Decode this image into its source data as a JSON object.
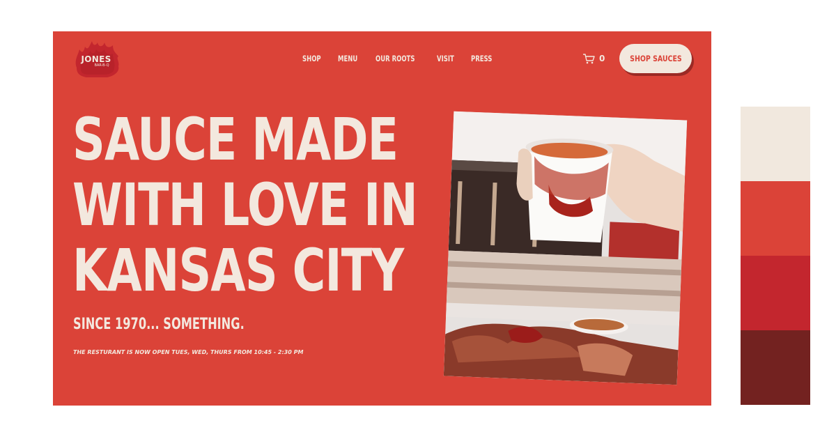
{
  "brand": {
    "name": "JONES",
    "sub": "BAR-B-Q"
  },
  "nav": {
    "items": [
      "SHOP",
      "MENU",
      "OUR ROOTS",
      "VISIT",
      "PRESS"
    ]
  },
  "cart": {
    "count": "0",
    "icon": "cart-icon"
  },
  "cta": {
    "label": "SHOP SAUCES"
  },
  "hero": {
    "headline_lines": [
      "SAUCE MADE",
      "WITH LOVE IN",
      "KANSAS CITY"
    ],
    "tagline": "SINCE 1970... SOMETHING.",
    "hours": "THE RESTURANT IS NOW OPEN TUES, WED, THURS FROM 10:45 - 2:30 PM"
  },
  "palette": [
    "#f1e8de",
    "#db4338",
    "#c3262e",
    "#732220"
  ],
  "colors": {
    "background": "#db4338",
    "cream": "#f3e8de",
    "shadow": "#9b2a25"
  }
}
